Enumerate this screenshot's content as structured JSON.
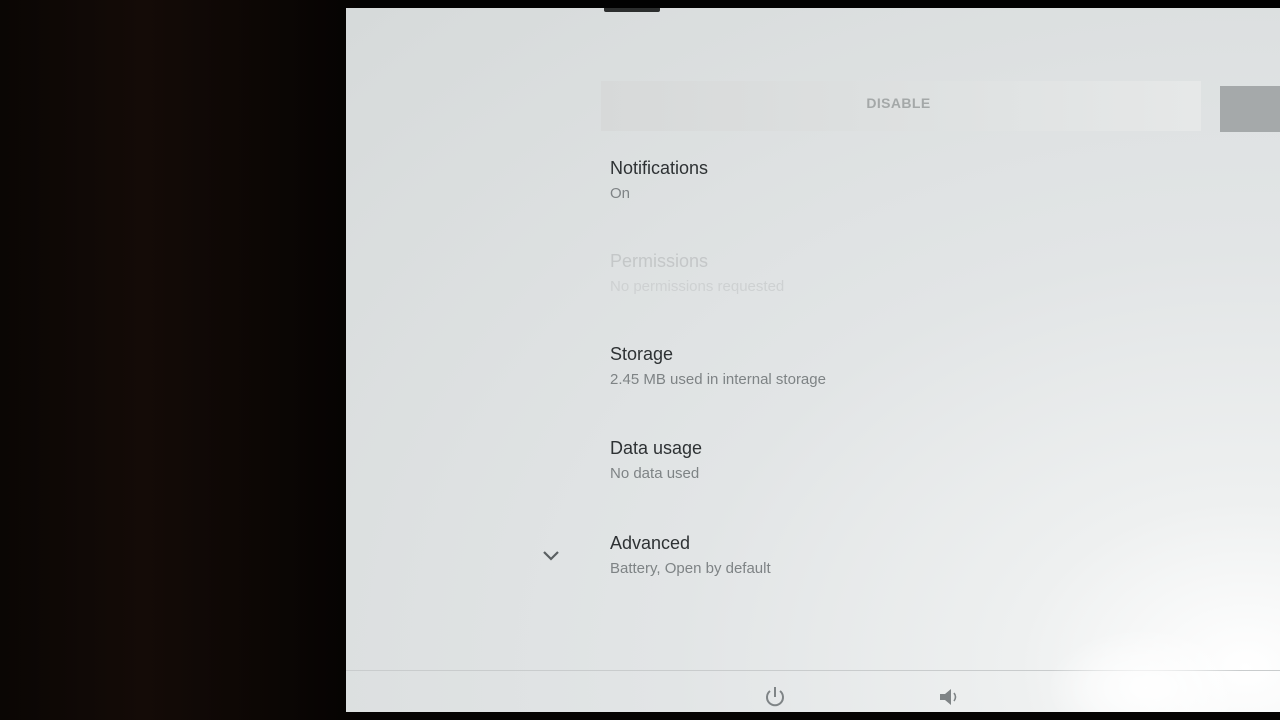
{
  "app_header": {
    "disable_label": "DISABLE"
  },
  "preferences": [
    {
      "title": "Notifications",
      "summary": "On",
      "enabled": true
    },
    {
      "title": "Permissions",
      "summary": "No permissions requested",
      "enabled": false
    },
    {
      "title": "Storage",
      "summary": "2.45 MB used in internal storage",
      "enabled": true
    },
    {
      "title": "Data usage",
      "summary": "No data used",
      "enabled": true
    },
    {
      "title": "Advanced",
      "summary": "Battery, Open by default",
      "enabled": true
    }
  ],
  "icons": {
    "advanced_toggle": "chevron-down-icon",
    "nav_power": "power-icon",
    "nav_volume": "volume-icon"
  },
  "colors": {
    "screen_background": "#e2e5e6",
    "title_text": "#2e3234",
    "summary_text": "#7e8385",
    "disabled_text": "#c4c7c8"
  }
}
